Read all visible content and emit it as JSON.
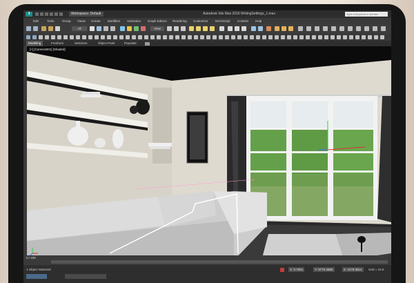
{
  "window": {
    "app_logo": "3",
    "workspace": "Workspace: Default",
    "title": "Autodesk 3ds Max 2016     WritingSettings_1.max",
    "search_placeholder": "Type a keyword or phrase"
  },
  "menu": [
    "Edit",
    "Tools",
    "Group",
    "Views",
    "Create",
    "Modifiers",
    "Animation",
    "Graph Editors",
    "Rendering",
    "Customize",
    "MAXScript",
    "Content",
    "Help"
  ],
  "toolbar": {
    "selection_filter": "All",
    "view_dropdown": "View"
  },
  "ribbon": {
    "tabs": [
      "Modeling",
      "Freeform",
      "Selection",
      "Object Paint",
      "Populate"
    ]
  },
  "viewport": {
    "label": "[+] [Camera001] [Shaded]"
  },
  "timeline": {
    "frame": "0 / 100"
  },
  "status": {
    "selection": "1 Object Selected",
    "x": "X: 0.7951",
    "y": "Y: 9770.4885",
    "z": "Z: 1279.3614",
    "grid": "Grid = 10.0"
  },
  "colors": {
    "app_bg": "#3c3c3c",
    "accent": "#1e8a8a",
    "viewport_wall": "#d9d5cb",
    "highlight": "#ffffff"
  }
}
